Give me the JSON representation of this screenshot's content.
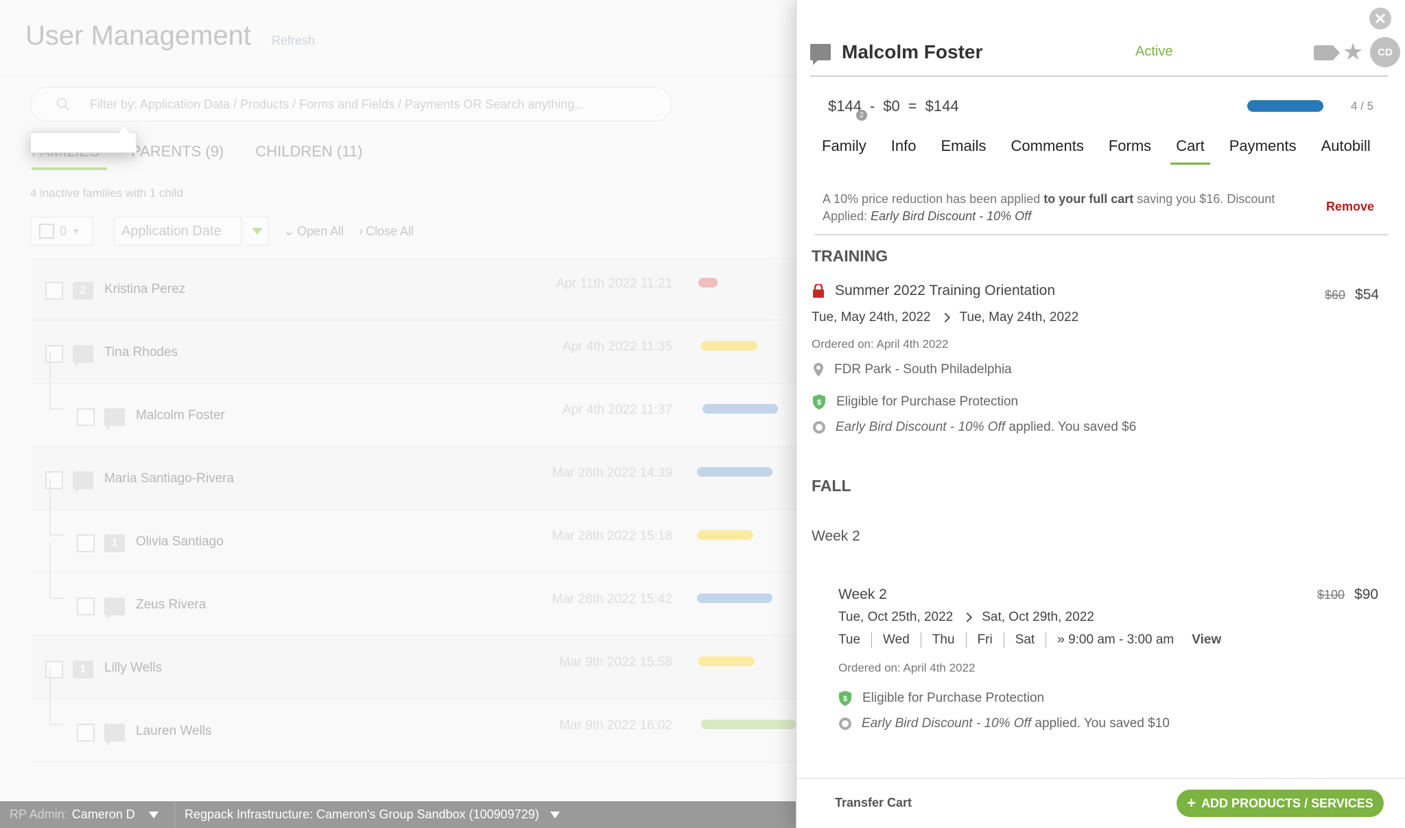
{
  "left": {
    "title": "User Management",
    "refresh_label": "Refresh",
    "filter_placeholder": "Filter by: Application Data / Products / Forms and Fields / Payments OR Search anything...",
    "tabs": [
      {
        "label": "FAMILIES"
      },
      {
        "label": "PARENTS (9)"
      },
      {
        "label": "CHILDREN (11)"
      }
    ],
    "summary": "4 inactive families with 1 child",
    "selected_count": "0",
    "sort_by": "Application Date",
    "open_all": "Open All",
    "close_all": "Close All",
    "rows": [
      {
        "name": "Kristina Perez",
        "date": "Apr 11th 2022 11:21",
        "badge": "2",
        "pill_color": "#e57373"
      },
      {
        "name": "Tina Rhodes",
        "date": "Apr 4th 2022 11:35",
        "badge": "",
        "pill_color": "#fdd835"
      },
      {
        "name": "Malcolm Foster",
        "date": "Apr 4th 2022 11:37",
        "badge": "",
        "pill_color": "#81a9d6"
      },
      {
        "name": "Maria Santiago-Rivera",
        "date": "Mar 28th 2022 14:39",
        "badge": "",
        "pill_color": "#81a9d6"
      },
      {
        "name": "Olivia Santiago",
        "date": "Mar 28th 2022 15:18",
        "badge": "1",
        "pill_color": "#fdd835"
      },
      {
        "name": "Zeus Rivera",
        "date": "Mar 28th 2022 15:42",
        "badge": "",
        "pill_color": "#81a9d6"
      },
      {
        "name": "Lilly Wells",
        "date": "Mar 9th 2022 15:58",
        "badge": "1",
        "pill_color": "#fdd835"
      },
      {
        "name": "Lauren Wells",
        "date": "Mar 9th 2022 16:02",
        "badge": "",
        "pill_color": "#aed581"
      }
    ],
    "status_bar": {
      "admin_label": "RP Admin:",
      "admin_name": "Cameron D",
      "org": "Regpack Infrastructure: Cameron's Group Sandbox (100909729)"
    }
  },
  "panel": {
    "name": "Malcolm Foster",
    "status": "Active",
    "avatar_initials": "CD",
    "money": {
      "gross": "$144",
      "gross_badge": "2",
      "minus": "-",
      "discount": "$0",
      "equals": "=",
      "total": "$144"
    },
    "progress": {
      "value": 4,
      "max": 5,
      "text": "4 / 5"
    },
    "tabs": [
      "Family",
      "Info",
      "Emails",
      "Comments",
      "Forms",
      "Cart",
      "Payments",
      "Autobill"
    ],
    "active_tab": "Cart",
    "discount_note": {
      "part1": "A 10% price reduction has been applied ",
      "bold": "to your full cart",
      "part2": " saving you $16. Discount Applied: ",
      "italic": "Early Bird Discount - 10% Off"
    },
    "remove_label": "Remove",
    "sections": {
      "training": {
        "title": "TRAINING",
        "item": {
          "name": "Summer 2022 Training Orientation",
          "old_price": "$60",
          "price": "$54",
          "start": "Tue, May 24th, 2022",
          "end": "Tue, May 24th, 2022",
          "ordered": "Ordered on:  April 4th 2022",
          "location": "FDR Park - South Philadelphia",
          "protection": "Eligible for Purchase Protection",
          "discount_name": "Early Bird Discount - 10% Off",
          "discount_saved": " applied. You saved $6"
        }
      },
      "fall": {
        "title": "FALL",
        "subtitle": "Week 2",
        "item": {
          "name": "Week 2",
          "old_price": "$100",
          "price": "$90",
          "start": "Tue, Oct 25th, 2022",
          "end": "Sat, Oct 29th, 2022",
          "days": [
            "Tue",
            "Wed",
            "Thu",
            "Fri",
            "Sat"
          ],
          "time": "» 9:00 am - 3:00 am",
          "view_label": "View",
          "ordered": "Ordered on:  April 4th 2022",
          "protection": "Eligible for Purchase Protection",
          "discount_name": "Early Bird Discount - 10% Off",
          "discount_saved": " applied. You saved $10"
        }
      }
    },
    "footer": {
      "transfer_label": "Transfer Cart",
      "add_label": "ADD PRODUCTS / SERVICES"
    },
    "colors": {
      "accent": "#7cb342",
      "progress": "#2879b9",
      "danger": "#b71c1c"
    }
  }
}
